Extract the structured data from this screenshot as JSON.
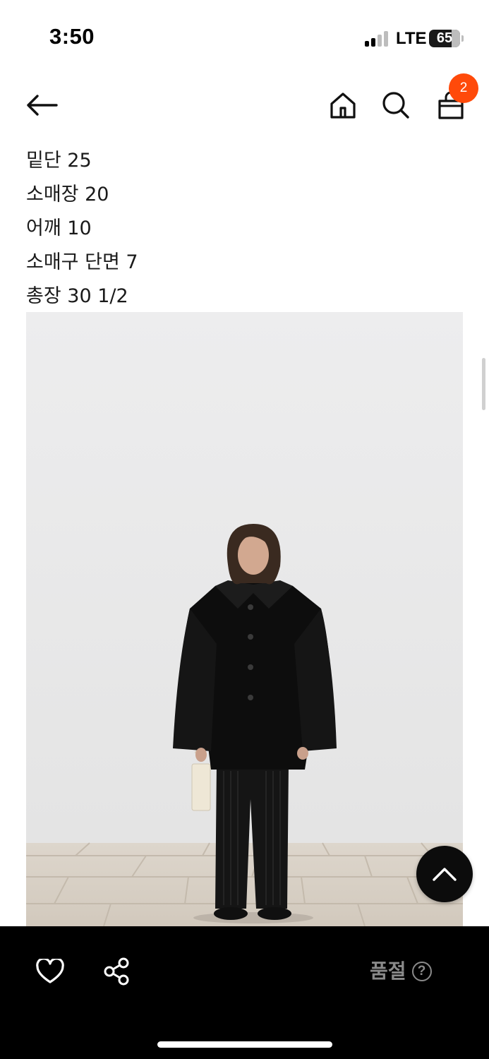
{
  "status_bar": {
    "time": "3:50",
    "network": "LTE",
    "battery": "65",
    "signal_bars_active": 2,
    "signal_bars_total": 4
  },
  "header": {
    "back_icon": "arrow-left-icon",
    "home_icon": "home-icon",
    "search_icon": "search-icon",
    "cart_icon": "shopping-bag-icon",
    "cart_count": "2",
    "badge_color": "#ff4a0a"
  },
  "size_info": [
    "밑단 25",
    "소매장 20",
    "어깨 10",
    "소매구 단면 7",
    "총장 30 1/2"
  ],
  "product_image": {
    "icon": "product-photo"
  },
  "scroll_to_top": {
    "icon": "chevron-up-icon"
  },
  "bottom_bar": {
    "like_icon": "heart-icon",
    "share_icon": "share-icon",
    "status_label": "품절",
    "help_symbol": "?",
    "status_color": "#8a8a8a"
  }
}
